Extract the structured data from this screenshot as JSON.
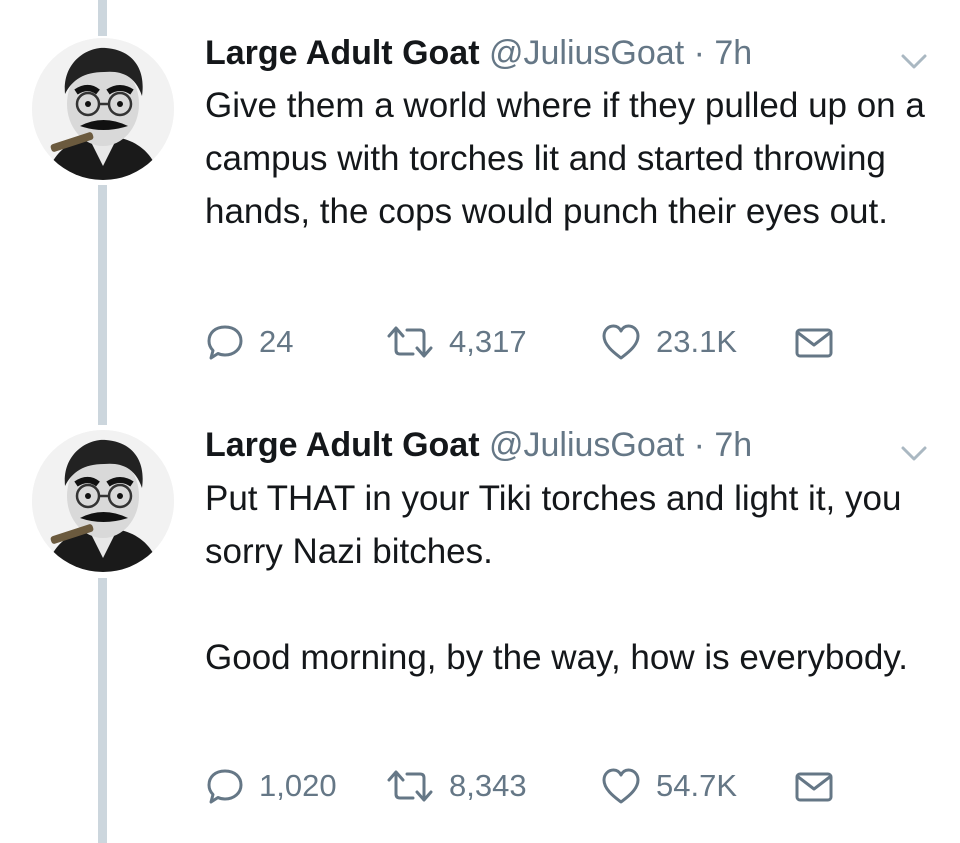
{
  "tweets": [
    {
      "name": "Large Adult Goat",
      "handle": "@JuliusGoat",
      "separator": "·",
      "time": "7h",
      "paragraphs": [
        "Give them a world where if they pulled up on a campus with torches lit and started throwing hands, the cops would punch their eyes out."
      ],
      "replies": "24",
      "retweets": "4,317",
      "likes": "23.1K"
    },
    {
      "name": "Large Adult Goat",
      "handle": "@JuliusGoat",
      "separator": "·",
      "time": "7h",
      "paragraphs": [
        "Put THAT in your Tiki torches and light it, you sorry Nazi bitches.",
        "Good morning, by the way, how is everybody."
      ],
      "replies": "1,020",
      "retweets": "8,343",
      "likes": "54.7K"
    }
  ],
  "icons": {
    "reply": "reply-bubble-icon",
    "retweet": "retweet-arrows-icon",
    "like": "heart-icon",
    "dm": "envelope-icon",
    "menu": "chevron-down-icon"
  },
  "colors": {
    "text": "#14171a",
    "secondary": "#657786",
    "thread_line": "#ccd6dd",
    "background": "#ffffff"
  }
}
